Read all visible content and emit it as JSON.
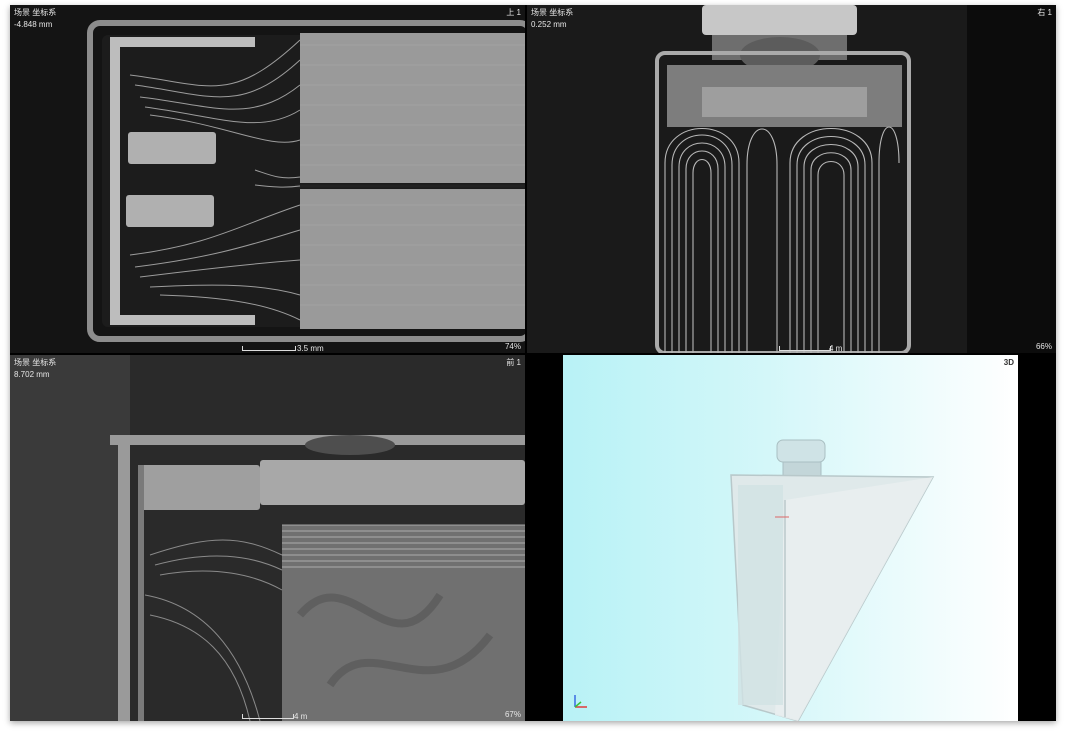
{
  "viewports": {
    "top": {
      "label": "场景 坐标系",
      "depth": "-4.848 mm",
      "view": "上 1",
      "scale": "3.5 mm",
      "zoom": "74%"
    },
    "right": {
      "label": "场景 坐标系",
      "depth": "0.252 mm",
      "view": "右 1",
      "scale": "4 m",
      "zoom": "66%"
    },
    "front": {
      "label": "场景 坐标系",
      "depth": "8.702 mm",
      "view": "前 1",
      "scale": "4 m",
      "zoom": "67%"
    },
    "three_d": {
      "view": "3D"
    }
  },
  "colors": {
    "background": "#000000",
    "ct_gray": "#8a8a8a",
    "sky_left": "#b8f2f6",
    "sky_right": "#ffffff",
    "axis_x": "#e23a3a",
    "axis_y": "#3ac23a",
    "axis_z": "#3a6ae2"
  },
  "icons": [
    "axis-gizmo-icon"
  ]
}
